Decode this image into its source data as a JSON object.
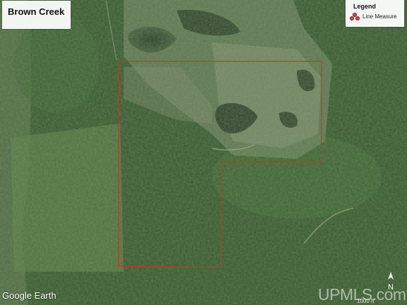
{
  "map": {
    "title": "Brown Creek",
    "legend": {
      "title": "Legend",
      "items": [
        {
          "label": "Line Measure",
          "icon": "line-measure-icon",
          "color": "#d64545"
        }
      ]
    },
    "boundary_color": "#c0392b",
    "attribution": "Google Earth",
    "watermark": "UPMLS.com",
    "scale_label": "1000 ft",
    "north_label": "N"
  }
}
